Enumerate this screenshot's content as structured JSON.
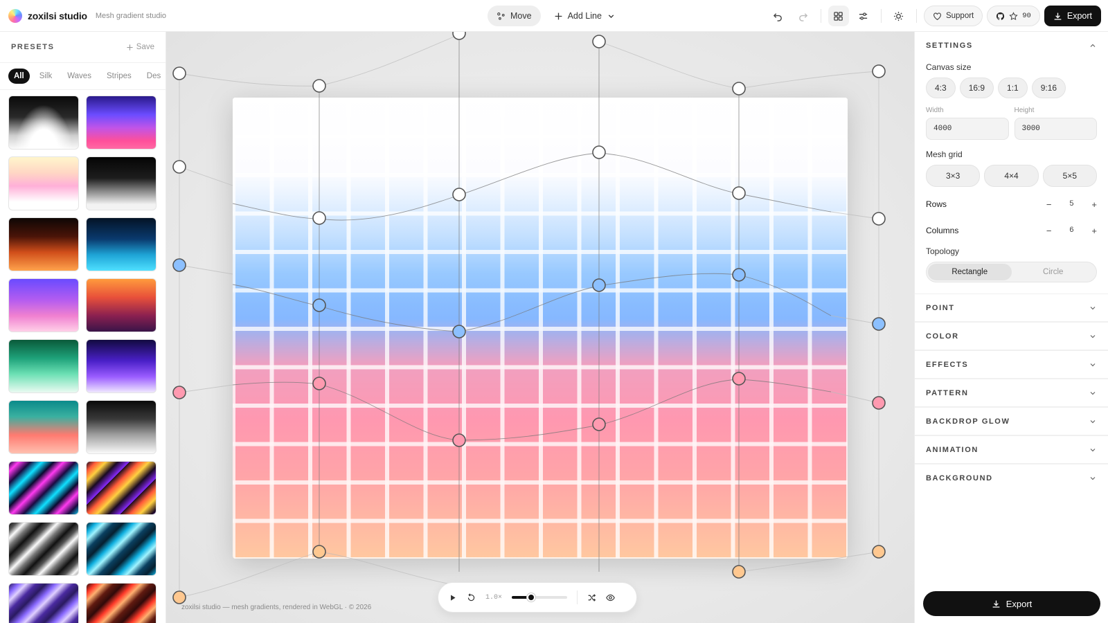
{
  "brand": {
    "name": "zoxilsi studio",
    "subtitle": "Mesh gradient studio"
  },
  "toolbar": {
    "move_label": "Move",
    "add_line_label": "Add Line",
    "support_label": "Support",
    "github_stars": "90",
    "export_label": "Export"
  },
  "presets": {
    "title": "PRESETS",
    "save_label": "Save",
    "filters": [
      "All",
      "Silk",
      "Waves",
      "Stripes",
      "Des"
    ],
    "active_filter": "All",
    "thumbnails": 18
  },
  "canvas": {
    "footer": "zoxilsi studio — mesh gradients, rendered in WebGL · © 2026",
    "speed": "1.0×"
  },
  "settings": {
    "title": "SETTINGS",
    "canvas_size_label": "Canvas size",
    "aspect_options": [
      "4:3",
      "16:9",
      "1:1",
      "9:16"
    ],
    "width_label": "Width",
    "height_label": "Height",
    "width_value": "4000",
    "height_value": "3000",
    "mesh_grid_label": "Mesh grid",
    "mesh_options": [
      "3×3",
      "4×4",
      "5×5"
    ],
    "rows_label": "Rows",
    "rows_value": "5",
    "columns_label": "Columns",
    "columns_value": "6",
    "topology_label": "Topology",
    "topology_options": [
      "Rectangle",
      "Circle"
    ],
    "topology_active": "Rectangle",
    "minus": "−",
    "plus": "+"
  },
  "sections": [
    "POINT",
    "COLOR",
    "EFFECTS",
    "PATTERN",
    "BACKDROP GLOW",
    "ANIMATION",
    "BACKGROUND"
  ],
  "bottom_export_label": "Export",
  "colors": {
    "accent_dark": "#111111",
    "point_blue": "#8cc0ff",
    "point_pink": "#ff9ab0",
    "point_peach": "#ffc890"
  }
}
